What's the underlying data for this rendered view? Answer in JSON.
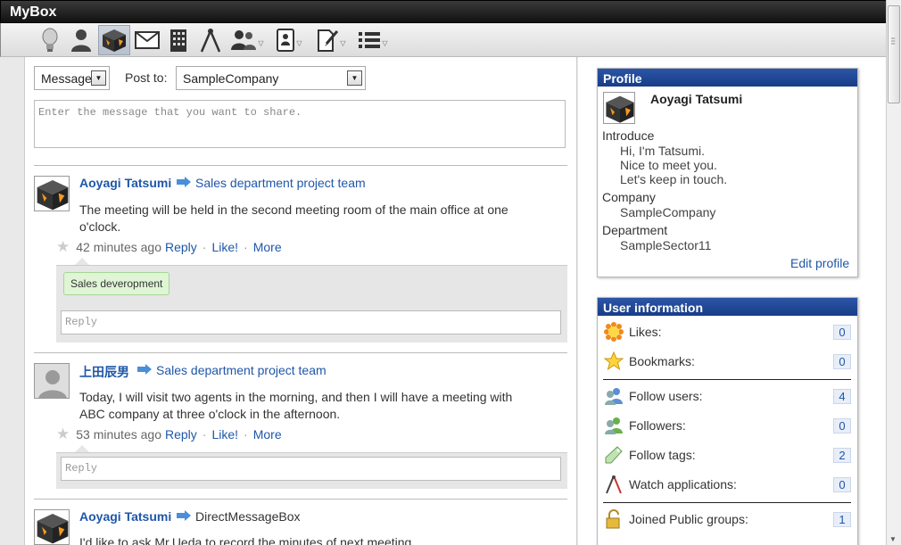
{
  "app": {
    "title": "MyBox"
  },
  "toolbar": {
    "icons": [
      "lightbulb-icon",
      "person-icon",
      "mybox-icon",
      "mail-icon",
      "building-icon",
      "compass-icon",
      "group-icon",
      "tablet-icon",
      "edit-icon",
      "list-icon"
    ]
  },
  "composer": {
    "type_value": "Message",
    "post_to_label": "Post to:",
    "post_to_value": "SampleCompany",
    "message_placeholder": "Enter the message that you want to share."
  },
  "posts": [
    {
      "author": "Aoyagi Tatsumi",
      "target": "Sales department project team",
      "text_line1": "The meeting will be held in the second meeting room of the main office at one",
      "text_line2": "o'clock.",
      "time": "42 minutes ago",
      "reply_label": "Reply",
      "like_label": "Like!",
      "more_label": "More",
      "tag": "Sales deveropment",
      "reply_placeholder": "Reply"
    },
    {
      "author": "上田辰男",
      "target": "Sales department project team",
      "text_line1": "Today, I will visit two agents in the morning, and then I will have a meeting with",
      "text_line2": "ABC company at three o'clock in the afternoon.",
      "time": "53 minutes ago",
      "reply_label": "Reply",
      "like_label": "Like!",
      "more_label": "More",
      "reply_placeholder": "Reply"
    },
    {
      "author": "Aoyagi Tatsumi",
      "target": "DirectMessageBox",
      "text_line1": "I'd like to ask Mr.Ueda to record the minutes of next meeting."
    }
  ],
  "profile": {
    "title": "Profile",
    "name": "Aoyagi Tatsumi",
    "introduce_label": "Introduce",
    "introduce_lines": [
      "Hi, I'm  Tatsumi.",
      "Nice to meet you.",
      "Let's keep in touch."
    ],
    "company_label": "Company",
    "company": "SampleCompany",
    "department_label": "Department",
    "department": "SampleSector11",
    "edit_link": "Edit profile"
  },
  "user_info": {
    "title": "User information",
    "rows": [
      {
        "label": "Likes:",
        "count": "0",
        "icon": "flower-icon"
      },
      {
        "label": "Bookmarks:",
        "count": "0",
        "icon": "star-icon"
      },
      {
        "label": "Follow users:",
        "count": "4",
        "icon": "follow-users-icon"
      },
      {
        "label": "Followers:",
        "count": "0",
        "icon": "followers-icon"
      },
      {
        "label": "Follow tags:",
        "count": "2",
        "icon": "tag-icon"
      },
      {
        "label": "Watch applications:",
        "count": "0",
        "icon": "compass-icon"
      },
      {
        "label": "Joined Public groups:",
        "count": "1",
        "icon": "padlock-open-icon"
      }
    ]
  },
  "colors": {
    "link": "#1f57a8",
    "panel_header": "#2c55a6",
    "titlebar": "#111111"
  }
}
